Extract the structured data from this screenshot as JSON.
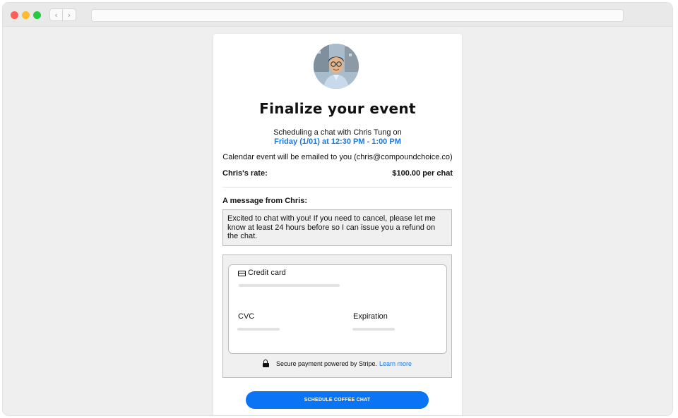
{
  "browser": {
    "url": ""
  },
  "event": {
    "title": "Finalize your event",
    "scheduling_text": "Scheduling a chat with Chris Tung on",
    "when": "Friday (1/01) at 12:30 PM - 1:00 PM",
    "email_note": "Calendar event will be emailed to you (chris@compoundchoice.co)",
    "rate_label": "Chris's rate:",
    "rate_value": "$100.00 per chat"
  },
  "message": {
    "label": "A message from Chris:",
    "text": "Excited to chat with you! If you need to cancel, please let me know at least 24 hours before so I can issue you a refund on the chat."
  },
  "payment": {
    "method_label": "Credit card",
    "cvc_label": "CVC",
    "expiration_label": "Expiration",
    "secure_text": "Secure payment powered by Stripe.",
    "learn_more": "Learn more"
  },
  "cta": {
    "label": "SCHEDULE COFFEE CHAT"
  },
  "colors": {
    "accent": "#0a74f5",
    "link": "#1479e6"
  },
  "icons": [
    "chevron-left-icon",
    "chevron-right-icon",
    "credit-card-icon",
    "lock-icon"
  ]
}
